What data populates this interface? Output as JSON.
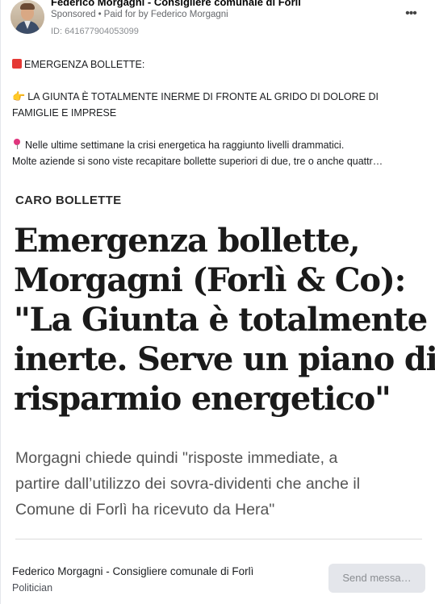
{
  "header": {
    "page_name": "Federico Morgagni - Consigliere comunale di Forlì",
    "sponsored": "Sponsored",
    "separator": "•",
    "paid_for": "Paid for by Federico Morgagni",
    "ad_id": "ID: 641677904053099",
    "more_label": "•••"
  },
  "post": {
    "line1": "EMERGENZA BOLLETTE:",
    "line2": "LA GIUNTA È TOTALMENTE INERME DI FRONTE AL GRIDO DI DOLORE DI",
    "line3": "FAMIGLIE E IMPRESE",
    "line4": "Nelle ultime settimane la crisi energetica ha raggiunto livelli drammatici.",
    "line5": "Molte aziende si sono viste recapitare bollette superiori di due, tre o anche quattr…",
    "icons": [
      "red-square-icon",
      "pointing-hand-icon",
      "pushpin-icon"
    ]
  },
  "creative": {
    "kicker": "CARO BOLLETTE",
    "headline_lines": [
      "Emergenza bollette,",
      "Morgagni (Forlì & Co):",
      "\"La Giunta è totalmente",
      "inerte. Serve un piano di",
      "risparmio energetico\""
    ],
    "subhead_lines": [
      "Morgagni chiede quindi \"risposte immediate, a",
      "partire dall’utilizzo dei sovra-dividenti che anche il",
      "Comune di Forlì ha ricevuto da Hera\""
    ]
  },
  "footer": {
    "name": "Federico Morgagni - Consigliere comunale di Forlì",
    "category": "Politician",
    "send_button": "Send messa…"
  },
  "colors": {
    "accent_red": "#e53935",
    "muted_text": "#65676b",
    "button_bg": "#e4e6eb"
  }
}
